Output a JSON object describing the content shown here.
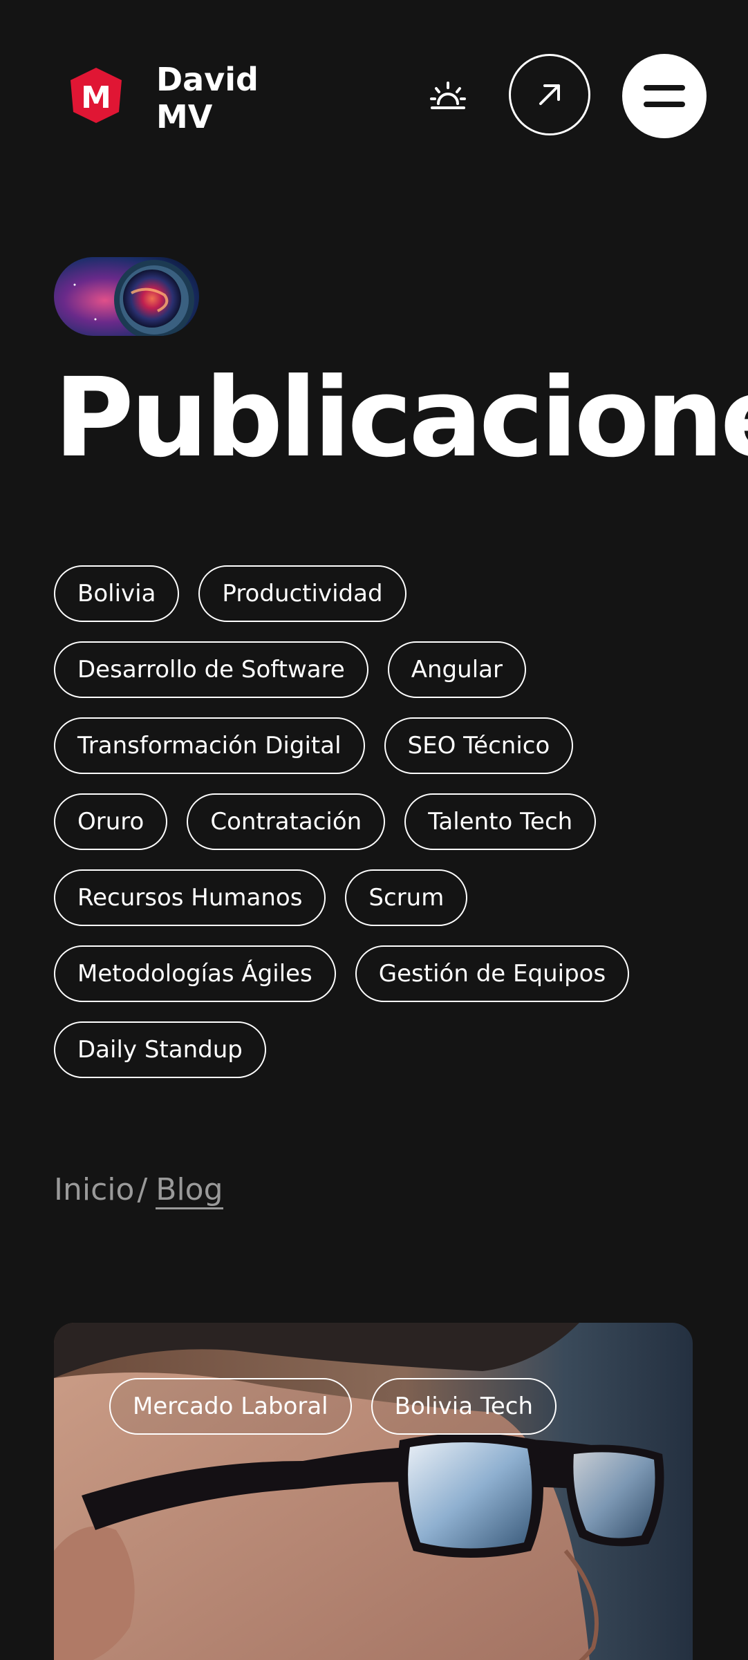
{
  "header": {
    "brand_name": "David\nMV",
    "logo_letter": "M",
    "icons": {
      "logo": "shield-m-logo",
      "theme": "sunrise-icon",
      "external": "arrow-up-right-icon",
      "menu": "hamburger-icon"
    }
  },
  "hero": {
    "image": "astronaut-helmet-nebula",
    "title": "Publicaciones"
  },
  "tags": [
    "Bolivia",
    "Productividad",
    "Desarrollo de Software",
    "Angular",
    "Transformación Digital",
    "SEO Técnico",
    "Oruro",
    "Contratación",
    "Talento Tech",
    "Recursos Humanos",
    "Scrum",
    "Metodologías Ágiles",
    "Gestión de Equipos",
    "Daily Standup"
  ],
  "breadcrumb": {
    "home": "Inicio",
    "separator": "/",
    "current": "Blog"
  },
  "card": {
    "image": "man-with-glasses-closeup",
    "tags": [
      "Mercado Laboral",
      "Bolivia Tech"
    ]
  },
  "colors": {
    "background": "#141414",
    "foreground": "#ffffff",
    "muted": "#9a9a9a",
    "logo_red": "#e01634"
  }
}
